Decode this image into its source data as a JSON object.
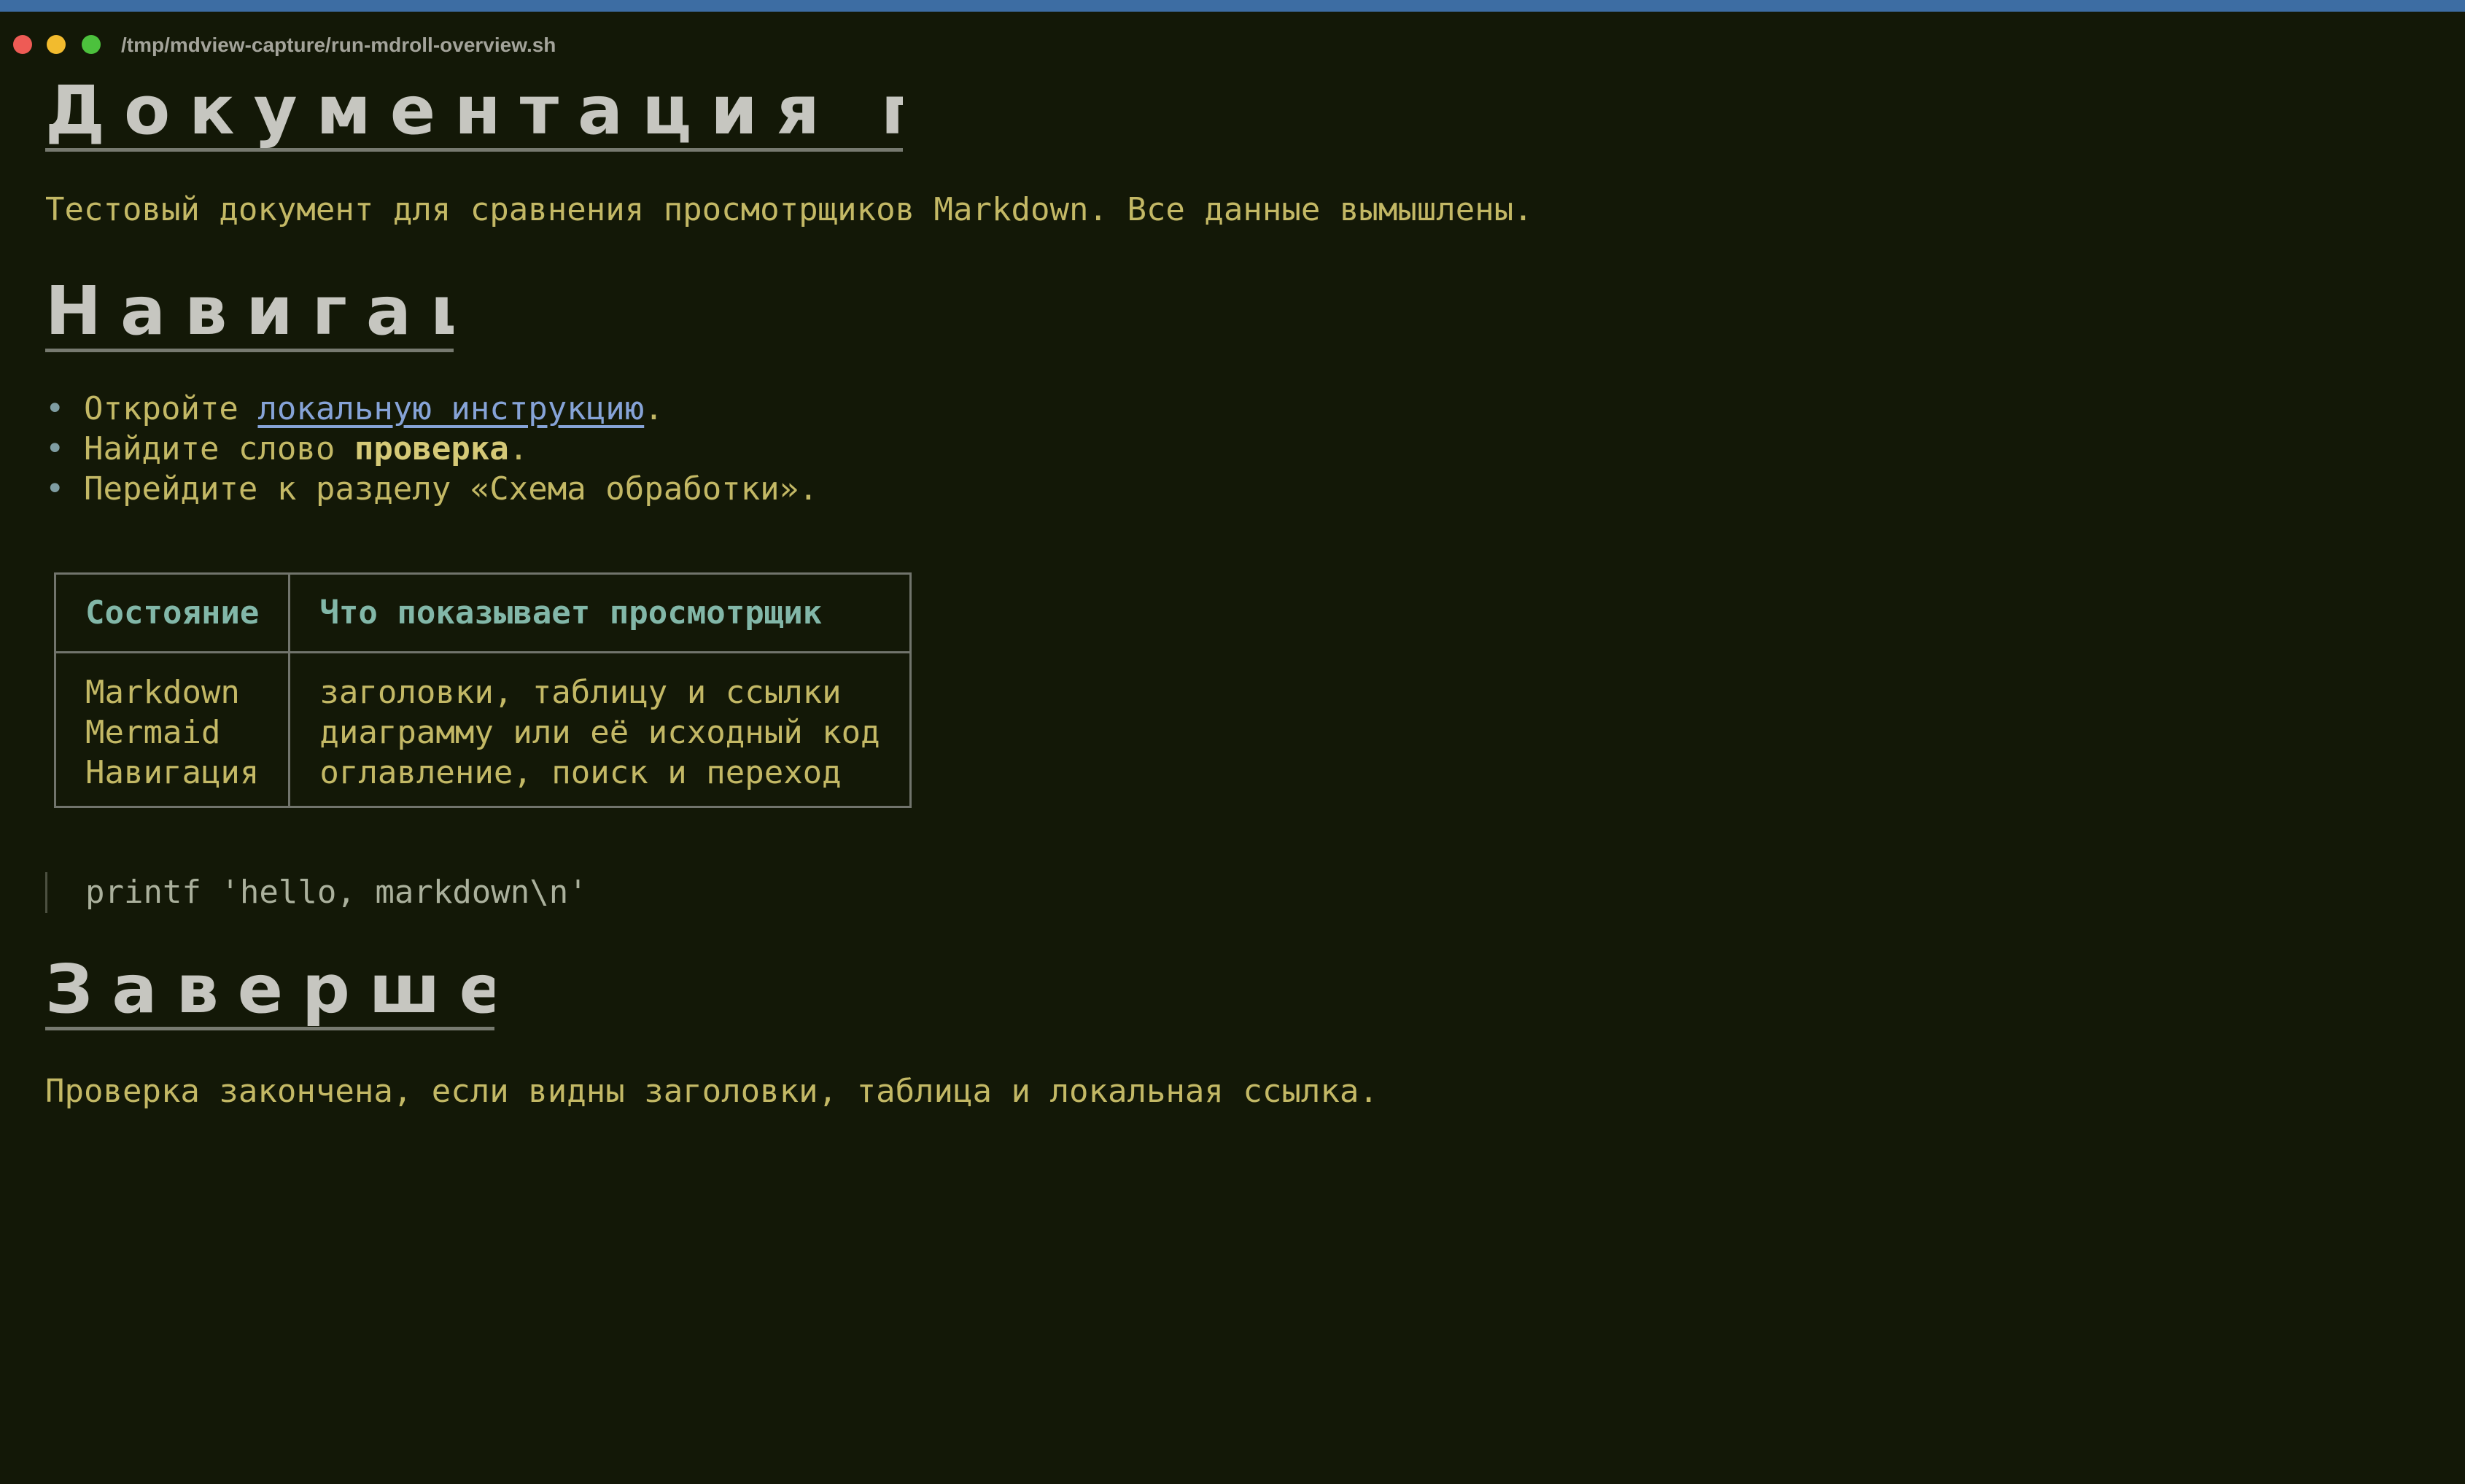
{
  "window": {
    "title": "/tmp/mdview-capture/run-mdroll-overview.sh"
  },
  "document": {
    "heading1": "Документация пр",
    "intro": "Тестовый документ для сравнения просмотрщиков Markdown. Все данные вымышлены.",
    "heading2": "Навигац",
    "bullets": {
      "marker": "•",
      "b1_before": "Откройте ",
      "b1_link": "локальную инструкцию",
      "b1_after": ".",
      "b2_before": "Найдите слово ",
      "b2_bold": "проверка",
      "b2_after": ".",
      "b3": "Перейдите к разделу «Схема обработки»."
    },
    "table": {
      "headers": [
        "Состояние",
        "Что показывает просмотрщик"
      ],
      "col1": [
        "Markdown",
        "Mermaid",
        "Навигация"
      ],
      "col2": [
        "заголовки, таблицу и ссылки",
        "диаграмму или её исходный код",
        "оглавление, поиск и переход"
      ]
    },
    "code": "printf 'hello, markdown\\n'",
    "heading3": "Заверше",
    "outro": "Проверка закончена, если видны заголовки, таблица и локальная ссылка."
  },
  "colors": {
    "background": "#131807",
    "text": "#c3b865",
    "heading": "#c6c6c0",
    "link": "#86a3d7",
    "table_header": "#82b7a8",
    "code": "#aab09c"
  }
}
